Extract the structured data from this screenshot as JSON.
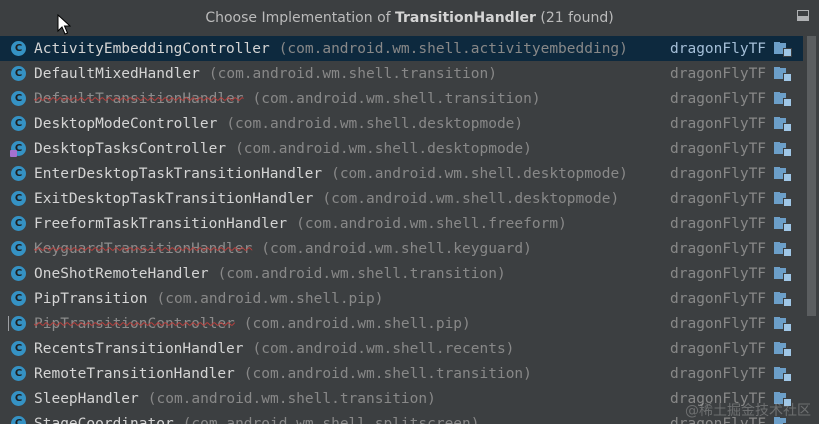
{
  "popup": {
    "title_prefix": "Choose Implementation of ",
    "title_class": "TransitionHandler",
    "title_suffix": " (21 found)"
  },
  "colors": {
    "background": "#3c3f41",
    "selected_row": "#0d293e",
    "class_icon": "#3592c4",
    "folder_icon": "#6c9fc9"
  },
  "rows": [
    {
      "name": "ActivityEmbeddingController",
      "package": "(com.android.wm.shell.activityembedding)",
      "module": "dragonFlyTF",
      "icon": "class-icon",
      "deprecated": false,
      "selected": true
    },
    {
      "name": "DefaultMixedHandler",
      "package": "(com.android.wm.shell.transition)",
      "module": "dragonFlyTF",
      "icon": "class-icon",
      "deprecated": false,
      "selected": false
    },
    {
      "name": "DefaultTransitionHandler",
      "package": "(com.android.wm.shell.transition)",
      "module": "dragonFlyTF",
      "icon": "class-icon",
      "deprecated": true,
      "selected": false
    },
    {
      "name": "DesktopModeController",
      "package": "(com.android.wm.shell.desktopmode)",
      "module": "dragonFlyTF",
      "icon": "class-icon",
      "deprecated": false,
      "selected": false
    },
    {
      "name": "DesktopTasksController",
      "package": "(com.android.wm.shell.desktopmode)",
      "module": "dragonFlyTF",
      "icon": "kotlin-class-icon",
      "deprecated": false,
      "selected": false
    },
    {
      "name": "EnterDesktopTaskTransitionHandler",
      "package": "(com.android.wm.shell.desktopmode)",
      "module": "dragonFlyTF",
      "icon": "class-icon",
      "deprecated": false,
      "selected": false
    },
    {
      "name": "ExitDesktopTaskTransitionHandler",
      "package": "(com.android.wm.shell.desktopmode)",
      "module": "dragonFlyTF",
      "icon": "class-icon",
      "deprecated": false,
      "selected": false
    },
    {
      "name": "FreeformTaskTransitionHandler",
      "package": "(com.android.wm.shell.freeform)",
      "module": "dragonFlyTF",
      "icon": "class-icon",
      "deprecated": false,
      "selected": false
    },
    {
      "name": "KeyguardTransitionHandler",
      "package": "(com.android.wm.shell.keyguard)",
      "module": "dragonFlyTF",
      "icon": "class-icon",
      "deprecated": true,
      "selected": false
    },
    {
      "name": "OneShotRemoteHandler",
      "package": "(com.android.wm.shell.transition)",
      "module": "dragonFlyTF",
      "icon": "class-icon",
      "deprecated": false,
      "selected": false
    },
    {
      "name": "PipTransition",
      "package": "(com.android.wm.shell.pip)",
      "module": "dragonFlyTF",
      "icon": "class-icon",
      "deprecated": false,
      "selected": false
    },
    {
      "name": "PipTransitionController",
      "package": "(com.android.wm.shell.pip)",
      "module": "dragonFlyTF",
      "icon": "abstract-class-icon",
      "deprecated": true,
      "selected": false
    },
    {
      "name": "RecentsTransitionHandler",
      "package": "(com.android.wm.shell.recents)",
      "module": "dragonFlyTF",
      "icon": "class-icon",
      "deprecated": false,
      "selected": false
    },
    {
      "name": "RemoteTransitionHandler",
      "package": "(com.android.wm.shell.transition)",
      "module": "dragonFlyTF",
      "icon": "class-icon",
      "deprecated": false,
      "selected": false
    },
    {
      "name": "SleepHandler",
      "package": "(com.android.wm.shell.transition)",
      "module": "dragonFlyTF",
      "icon": "class-icon",
      "deprecated": false,
      "selected": false
    },
    {
      "name": "StageCoordinator",
      "package": "(com.android.wm.shell.splitscreen)",
      "module": "dragonFlyTF",
      "icon": "class-icon",
      "deprecated": false,
      "selected": false
    }
  ],
  "watermark": "@稀土掘金技术社区"
}
